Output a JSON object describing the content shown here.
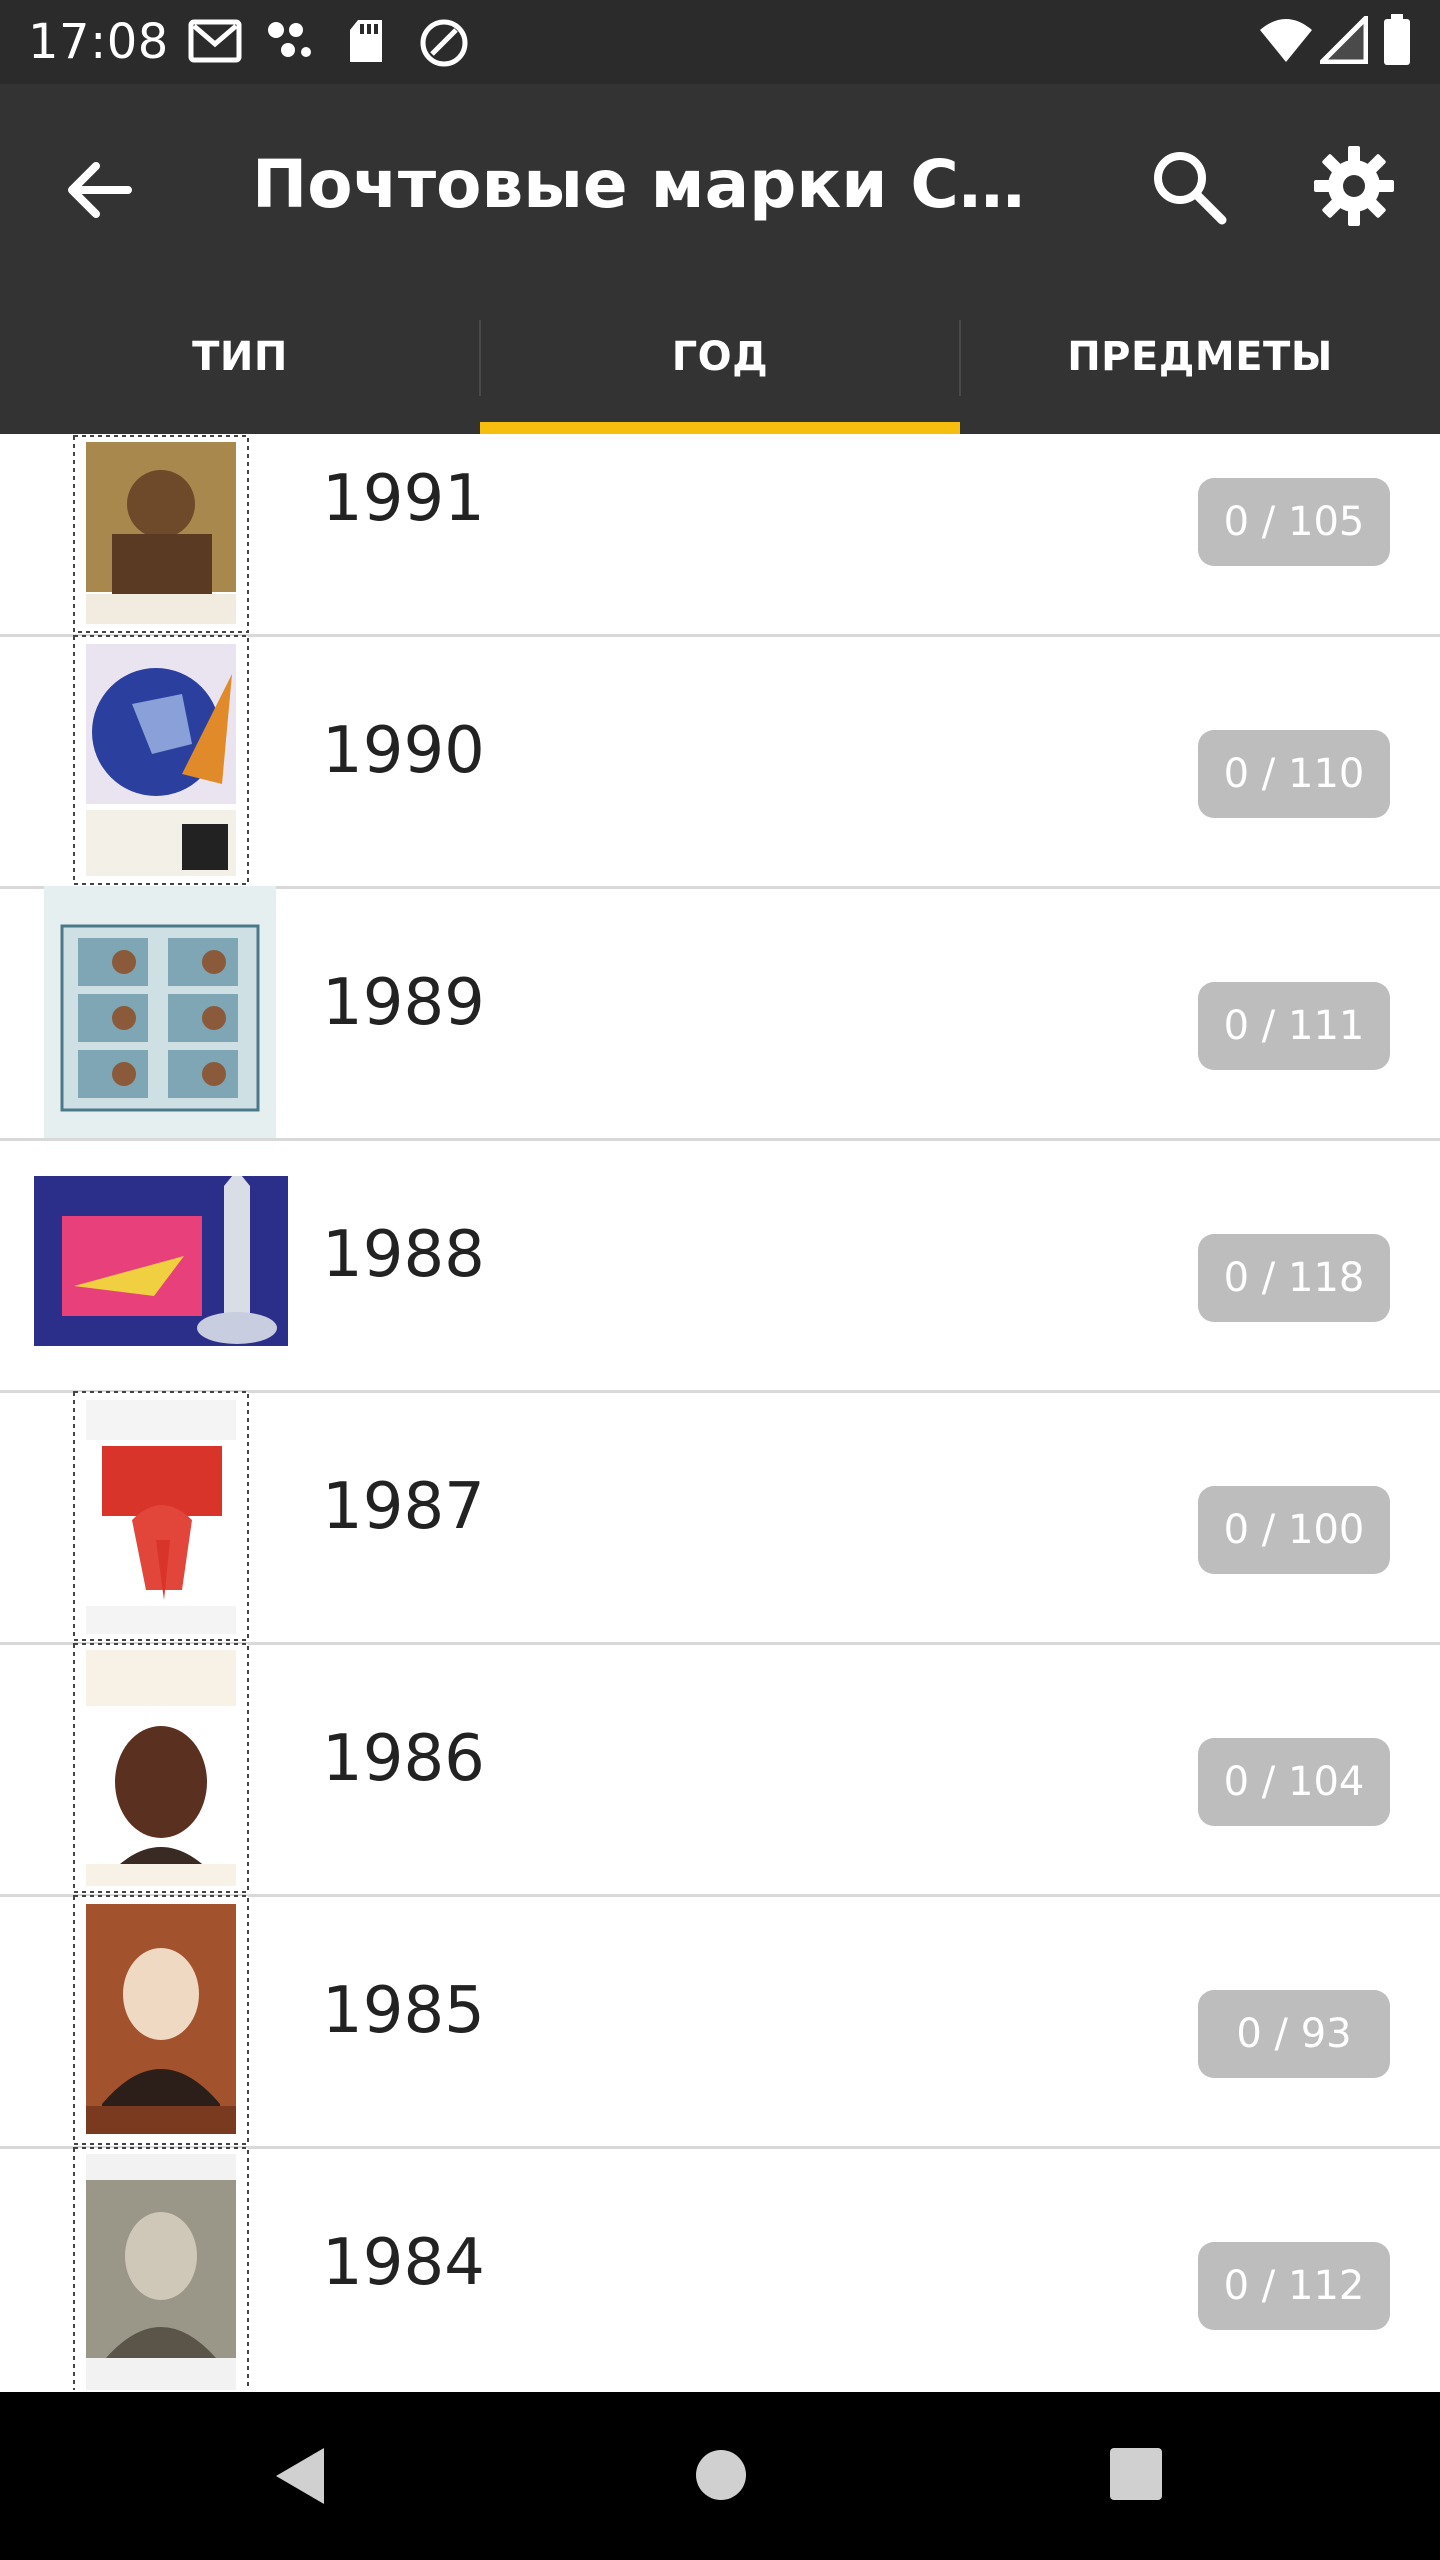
{
  "status_bar": {
    "time": "17:08",
    "left_icons": [
      "gmail-icon",
      "dots-icon",
      "sd-card-icon",
      "at-sign-icon"
    ],
    "right_icons": [
      "wifi-icon",
      "signal-icon",
      "battery-icon"
    ]
  },
  "toolbar": {
    "title": "Почтовые марки ССС…",
    "back_icon": "arrow-left-icon",
    "search_icon": "search-icon",
    "settings_icon": "gear-icon"
  },
  "tabs": [
    {
      "label": "ТИП",
      "selected": false
    },
    {
      "label": "ГОД",
      "selected": true
    },
    {
      "label": "ПРЕДМЕТЫ",
      "selected": false
    }
  ],
  "colors": {
    "toolbar": "#333333",
    "status_bar": "#2b2b2b",
    "indicator": "#f6be0e",
    "badge": "#bdbdbd"
  },
  "years": [
    {
      "year": "1991",
      "count": "0 / 105",
      "thumb": "stamp-portrait-icon"
    },
    {
      "year": "1990",
      "count": "0 / 110",
      "thumb": "stamp-globe-icon"
    },
    {
      "year": "1989",
      "count": "0 / 111",
      "thumb": "stamp-sheet-icon"
    },
    {
      "year": "1988",
      "count": "0 / 118",
      "thumb": "stamp-space-shuttle-icon"
    },
    {
      "year": "1987",
      "count": "0 / 100",
      "thumb": "stamp-torch-icon"
    },
    {
      "year": "1986",
      "count": "0 / 104",
      "thumb": "stamp-portrait-icon"
    },
    {
      "year": "1985",
      "count": "0 / 93",
      "thumb": "stamp-portrait-icon"
    },
    {
      "year": "1984",
      "count": "0 / 112",
      "thumb": "stamp-portrait-icon"
    }
  ],
  "nav_bar": {
    "back": "nav-back-icon",
    "home": "nav-home-icon",
    "recents": "nav-recents-icon"
  }
}
